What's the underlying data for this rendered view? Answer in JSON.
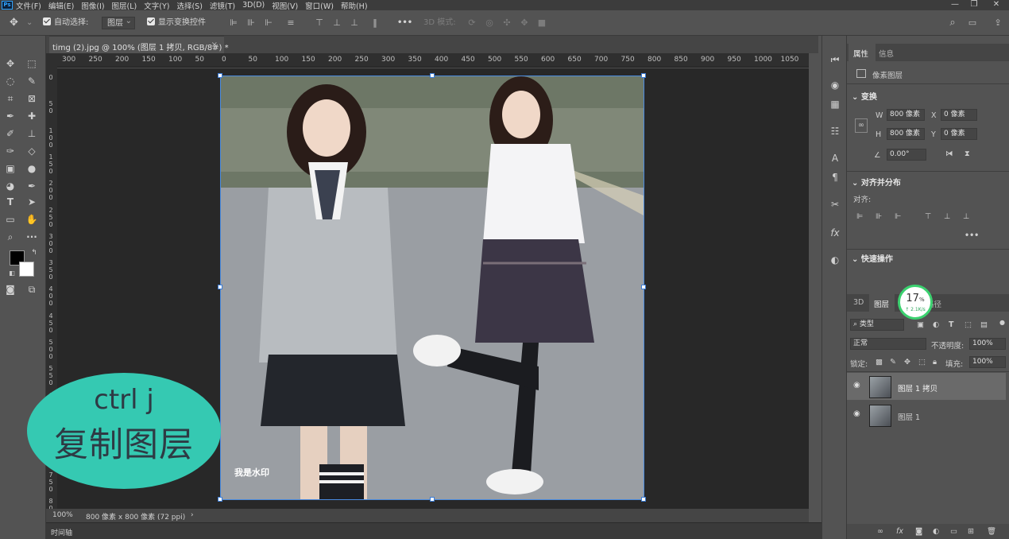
{
  "menu": {
    "logo": "Ps",
    "items": [
      "文件(F)",
      "编辑(E)",
      "图像(I)",
      "图层(L)",
      "文字(Y)",
      "选择(S)",
      "滤镜(T)",
      "3D(D)",
      "视图(V)",
      "窗口(W)",
      "帮助(H)"
    ]
  },
  "options": {
    "auto_select_label": "自动选择:",
    "auto_select_value": "图层",
    "show_transform_label": "显示变换控件",
    "more": "•••",
    "mode_3d_label": "3D 模式:"
  },
  "document": {
    "tab_title": "timg (2).jpg @ 100% (图层 1 拷贝, RGB/8#) *",
    "close": "×",
    "watermark": "我是水印",
    "zoom": "100%",
    "doc_info": "800 像素 x 800 像素 (72 ppi)",
    "status_arrow": "›"
  },
  "ruler": {
    "h_labels": [
      "300",
      "250",
      "200",
      "150",
      "100",
      "50",
      "0",
      "50",
      "100",
      "150",
      "200",
      "250",
      "300",
      "350",
      "400",
      "450",
      "500",
      "550",
      "600",
      "650",
      "700",
      "750",
      "800",
      "850",
      "900",
      "950",
      "1000",
      "1050"
    ],
    "v_labels": [
      "0",
      "5 0",
      "1 0 0",
      "1 5 0",
      "2 0 0",
      "2 5 0",
      "3 0 0",
      "3 5 0",
      "4 0 0",
      "4 5 0",
      "5 0 0",
      "5 5 0",
      "6 0 0",
      "6 5 0",
      "7 0 0",
      "7 5 0",
      "8 0 0"
    ]
  },
  "timeline": {
    "label": "时间轴"
  },
  "overlay": {
    "line1": "ctrl  j",
    "line2": "复制图层",
    "color": "#35c9b2"
  },
  "cpu_widget": {
    "percent": "17",
    "unit": "%",
    "speed": "↑ 2.1K/s"
  },
  "properties_panel": {
    "tabs": [
      "属性",
      "信息"
    ],
    "type_label": "像素图层",
    "transform": {
      "title": "变换",
      "w_label": "W",
      "w_value": "800 像素",
      "x_label": "X",
      "x_value": "0 像素",
      "h_label": "H",
      "h_value": "800 像素",
      "y_label": "Y",
      "y_value": "0 像素",
      "angle_value": "0.00°"
    },
    "align": {
      "title": "对齐并分布",
      "label": "对齐:",
      "more": "•••"
    },
    "quick_actions": {
      "title": "快速操作"
    }
  },
  "layers_panel": {
    "tabs": [
      "3D",
      "图层",
      "路径"
    ],
    "filter_label": "类型",
    "blend_mode": "正常",
    "opacity_label": "不透明度:",
    "opacity_value": "100%",
    "lock_label": "锁定:",
    "fill_label": "填充:",
    "fill_value": "100%",
    "layers": [
      {
        "name": "图层 1 拷贝",
        "selected": true
      },
      {
        "name": "图层 1",
        "selected": false
      }
    ]
  }
}
